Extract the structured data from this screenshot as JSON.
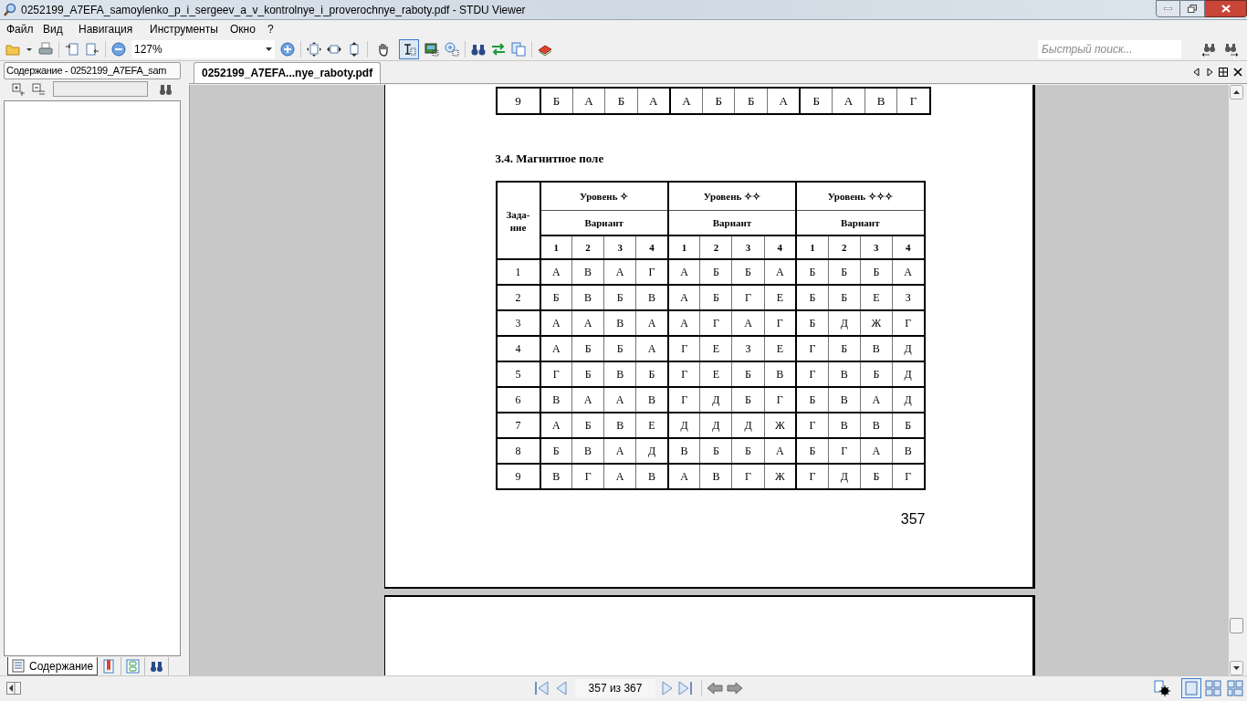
{
  "window": {
    "title": "0252199_A7EFA_samoylenko_p_i_sergeev_a_v_kontrolnye_i_proverochnye_raboty.pdf - STDU Viewer"
  },
  "menu": [
    "Файл",
    "Вид",
    "Навигация",
    "Инструменты",
    "Окно",
    "?"
  ],
  "toolbar": {
    "zoom": "127%",
    "tool_modes": [
      {
        "selected": false
      },
      {
        "selected": true
      }
    ],
    "search": {
      "placeholder": "Быстрый поиск..."
    }
  },
  "sidebar": {
    "title": "Содержание - 0252199_A7EFA_sam",
    "tabs": [
      {
        "kind": "contents",
        "label": "Содержание",
        "selected": true
      },
      {
        "kind": "bookmarks",
        "selected": false
      },
      {
        "kind": "thumbnails",
        "selected": false
      },
      {
        "kind": "search",
        "selected": false
      }
    ]
  },
  "document_tab": {
    "label": "0252199_A7EFA...nye_raboty.pdf"
  },
  "page": {
    "previous_table_row": [
      "9",
      "Б",
      "А",
      "Б",
      "А",
      "А",
      "Б",
      "Б",
      "А",
      "Б",
      "А",
      "В",
      "Г"
    ],
    "section_heading": "3.4. Магнитное поле",
    "table": {
      "task_header": "Зада-\nние",
      "levels": [
        {
          "label": "Уровень ✧",
          "variant_label": "Вариант",
          "variants": [
            "1",
            "2",
            "3",
            "4"
          ]
        },
        {
          "label": "Уровень ✧✧",
          "variant_label": "Вариант",
          "variants": [
            "1",
            "2",
            "3",
            "4"
          ]
        },
        {
          "label": "Уровень ✧✧✧",
          "variant_label": "Вариант",
          "variants": [
            "1",
            "2",
            "3",
            "4"
          ]
        }
      ],
      "rows": [
        [
          "1",
          "А",
          "В",
          "А",
          "Г",
          "А",
          "Б",
          "Б",
          "А",
          "Б",
          "Б",
          "Б",
          "А"
        ],
        [
          "2",
          "Б",
          "В",
          "Б",
          "В",
          "А",
          "Б",
          "Г",
          "Е",
          "Б",
          "Б",
          "Е",
          "З"
        ],
        [
          "3",
          "А",
          "А",
          "В",
          "А",
          "А",
          "Г",
          "А",
          "Г",
          "Б",
          "Д",
          "Ж",
          "Г"
        ],
        [
          "4",
          "А",
          "Б",
          "Б",
          "А",
          "Г",
          "Е",
          "З",
          "Е",
          "Г",
          "Б",
          "В",
          "Д"
        ],
        [
          "5",
          "Г",
          "Б",
          "В",
          "Б",
          "Г",
          "Е",
          "Б",
          "В",
          "Г",
          "В",
          "Б",
          "Д"
        ],
        [
          "6",
          "В",
          "А",
          "А",
          "В",
          "Г",
          "Д",
          "Б",
          "Г",
          "Б",
          "В",
          "А",
          "Д"
        ],
        [
          "7",
          "А",
          "Б",
          "В",
          "Е",
          "Д",
          "Д",
          "Д",
          "Ж",
          "Г",
          "В",
          "В",
          "Б"
        ],
        [
          "8",
          "Б",
          "В",
          "А",
          "Д",
          "В",
          "Б",
          "Б",
          "А",
          "Б",
          "Г",
          "А",
          "В"
        ],
        [
          "9",
          "В",
          "Г",
          "А",
          "В",
          "А",
          "В",
          "Г",
          "Ж",
          "Г",
          "Д",
          "Б",
          "Г"
        ]
      ]
    },
    "page_number": "357"
  },
  "status_bar": {
    "page_indicator": "357 из 367",
    "view_modes": [
      {
        "selected": true
      },
      {
        "selected": false
      },
      {
        "selected": false
      }
    ]
  }
}
